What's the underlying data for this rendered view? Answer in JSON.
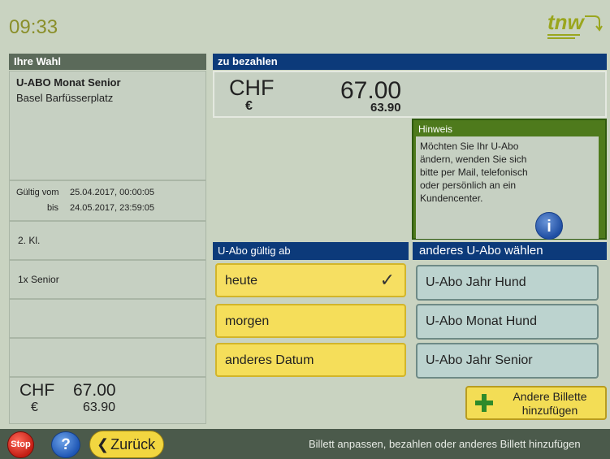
{
  "header": {
    "time": "09:33",
    "logo_text": "tnw",
    "logo_caption": ""
  },
  "selection": {
    "title": "Ihre Wahl",
    "product": "U-ABO Monat Senior",
    "place": "Basel Barfüsserplatz",
    "valid_from_label": "Gültig vom",
    "valid_from": "25.04.2017, 00:00:05",
    "valid_to_label": "bis",
    "valid_to": "24.05.2017, 23:59:05",
    "class": "2. Kl.",
    "passengers": "1x Senior",
    "total_chf_label": "CHF",
    "total_chf": "67.00",
    "total_eur_label": "€",
    "total_eur": "63.90"
  },
  "payment": {
    "title": "zu bezahlen",
    "chf_label": "CHF",
    "chf_value": "67.00",
    "eur_label": "€",
    "eur_value": "63.90"
  },
  "hint": {
    "title": "Hinweis",
    "text": "Möchten Sie Ihr U-Abo ändern, wenden Sie sich bitte per Mail, telefonisch oder persönlich an ein Kundencenter.",
    "icon": "info-icon"
  },
  "valid_from_section": {
    "title": "U-Abo gültig ab",
    "options": [
      "heute",
      "morgen",
      "anderes Datum"
    ],
    "selected": "heute"
  },
  "other_abo": {
    "title": "anderes U-Abo wählen",
    "options": [
      "U-Abo Jahr Hund",
      "U-Abo Monat Hund",
      "U-Abo Jahr Senior"
    ]
  },
  "add_other": {
    "label_line1": "Andere Billette",
    "label_line2": "hinzufügen"
  },
  "bottom_bar": {
    "stop": "Stop",
    "help": "?",
    "back": "Zurück",
    "status": "Billett anpassen, bezahlen oder anderes Billett hinzufügen"
  },
  "colors": {
    "background": "#c9d3c1",
    "title_blue": "#0c3a7a",
    "title_grey": "#5b6a5a",
    "yellow_button": "#f5de5a",
    "green_button": "#bcd3cf",
    "hint_green": "#4e7a1c"
  }
}
